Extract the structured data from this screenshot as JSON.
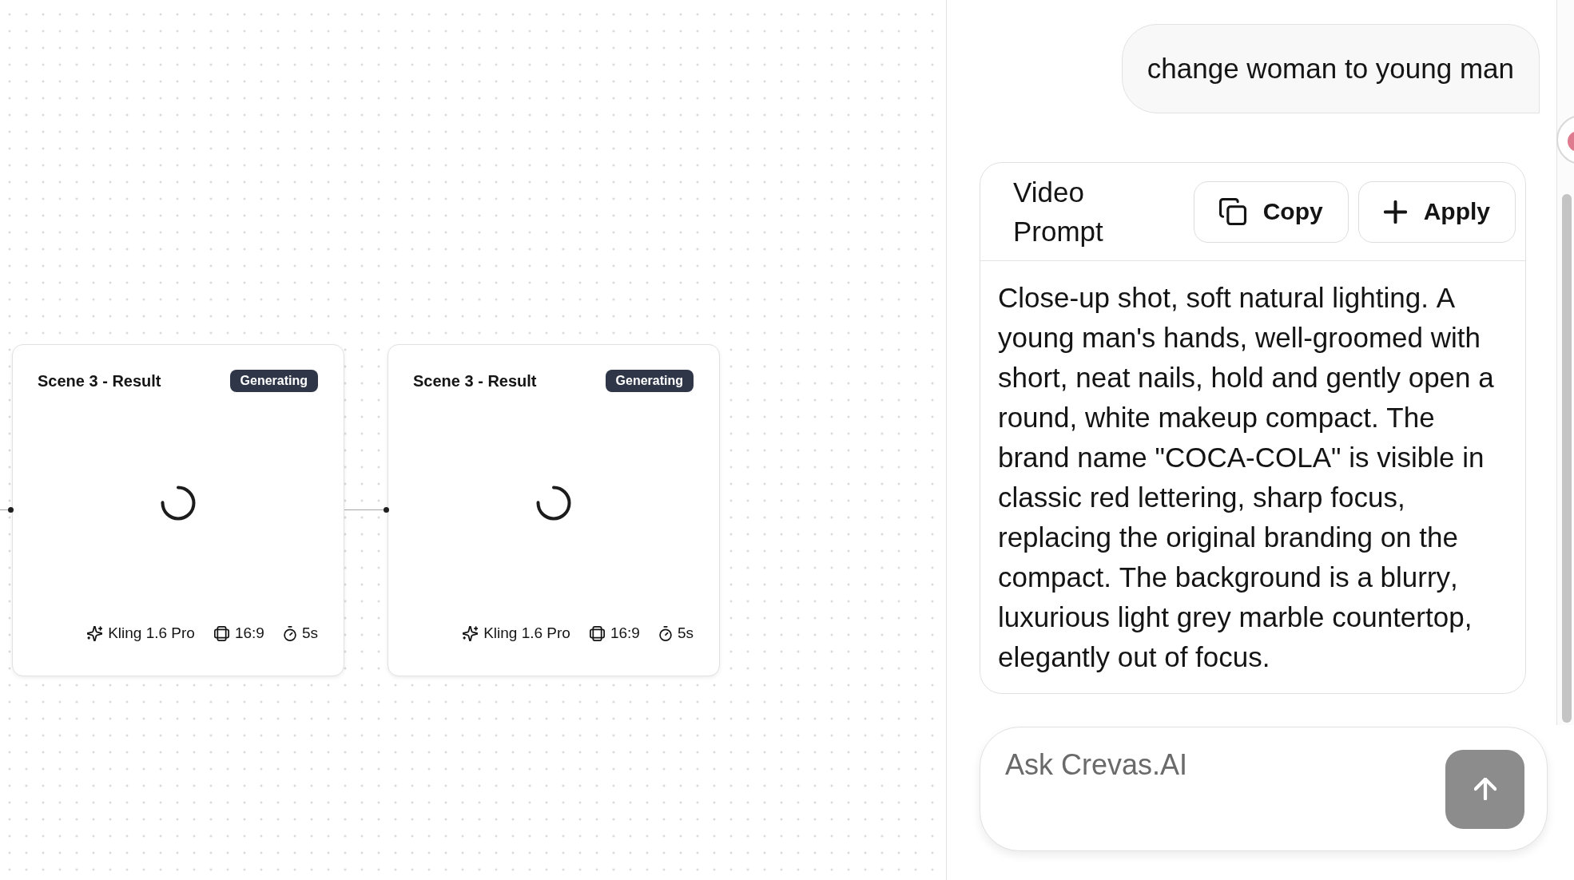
{
  "canvas": {
    "nodes": [
      {
        "title": "Scene 3 - Result",
        "status": "Generating",
        "loading": true,
        "model": "Kling 1.6 Pro",
        "aspect_ratio": "16:9",
        "duration": "5s"
      },
      {
        "title": "Scene 3 - Result",
        "status": "Generating",
        "loading": true,
        "model": "Kling 1.6 Pro",
        "aspect_ratio": "16:9",
        "duration": "5s"
      }
    ]
  },
  "chat": {
    "messages": [
      {
        "kind": "user",
        "text": "change woman to young man"
      },
      {
        "kind": "prompt",
        "title": "Video Prompt",
        "actions": [
          {
            "kind": "copy",
            "label": "Copy"
          },
          {
            "kind": "apply",
            "label": "Apply"
          }
        ],
        "text": "Close-up shot, soft natural lighting. A young man's hands, well-groomed with short, neat nails, hold and gently open a round, white makeup compact. The brand name \"COCA-COLA\" is visible in classic red lettering, sharp focus, replacing the original branding on the compact. The background is a blurry, luxurious light grey marble countertop, elegantly out of focus."
      }
    ],
    "composer": {
      "placeholder": "Ask Crevas.AI",
      "send_button": {
        "disabled": true
      }
    }
  }
}
